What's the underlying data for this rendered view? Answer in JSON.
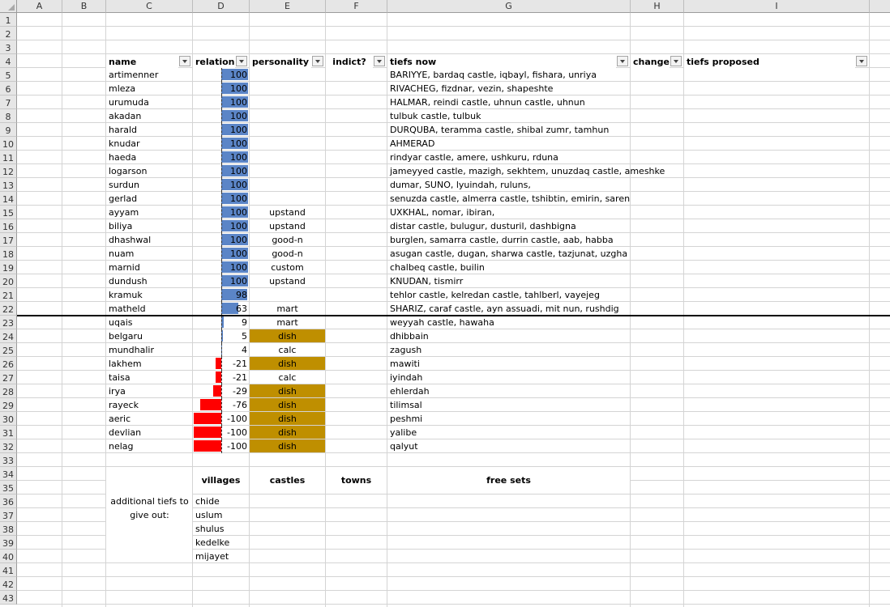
{
  "sheet": {
    "columns": [
      "A",
      "B",
      "C",
      "D",
      "E",
      "F",
      "G",
      "H",
      "I"
    ],
    "row_numbers": [
      1,
      2,
      3,
      4,
      5,
      6,
      7,
      8,
      9,
      10,
      11,
      12,
      13,
      14,
      15,
      16,
      17,
      18,
      19,
      20,
      21,
      22,
      23,
      24,
      25,
      26,
      27,
      28,
      29,
      30,
      31,
      32,
      33,
      34,
      35,
      36,
      37,
      38,
      39,
      40,
      41,
      42,
      43
    ]
  },
  "headers": {
    "name": "name",
    "relation": "relation",
    "personality": "personality",
    "indict": "indict?",
    "tiefs_now": "tiefs now",
    "changes": "changes?",
    "tiefs_proposed": "tiefs proposed"
  },
  "rows": [
    {
      "name": "artimenner",
      "relation": 100,
      "personality": "",
      "tiefs": "BARIYYE, bardaq castle, iqbayl, fishara, unriya"
    },
    {
      "name": "mleza",
      "relation": 100,
      "personality": "",
      "tiefs": "RIVACHEG, fizdnar, vezin, shapeshte"
    },
    {
      "name": "urumuda",
      "relation": 100,
      "personality": "",
      "tiefs": "HALMAR, reindi castle, uhnun castle, uhnun"
    },
    {
      "name": "akadan",
      "relation": 100,
      "personality": "",
      "tiefs": "tulbuk castle, tulbuk"
    },
    {
      "name": "harald",
      "relation": 100,
      "personality": "",
      "tiefs": "DURQUBA, teramma castle,  shibal zumr, tamhun"
    },
    {
      "name": "knudar",
      "relation": 100,
      "personality": "",
      "tiefs": "AHMERAD"
    },
    {
      "name": "haeda",
      "relation": 100,
      "personality": "",
      "tiefs": "rindyar castle, amere, ushkuru, rduna"
    },
    {
      "name": "logarson",
      "relation": 100,
      "personality": "",
      "tiefs": "jameyyed castle, mazigh, sekhtem, unuzdaq castle, ameshke"
    },
    {
      "name": "surdun",
      "relation": 100,
      "personality": "",
      "tiefs": "dumar, SUNO, lyuindah, ruluns,"
    },
    {
      "name": "gerlad",
      "relation": 100,
      "personality": "",
      "tiefs": "senuzda castle, almerra castle, tshibtin, emirin, saren"
    },
    {
      "name": "ayyam",
      "relation": 100,
      "personality": "upstand",
      "tiefs": "UXKHAL, nomar, ibiran,"
    },
    {
      "name": "biliya",
      "relation": 100,
      "personality": "upstand",
      "tiefs": "distar castle, bulugur, dusturil, dashbigna"
    },
    {
      "name": "dhashwal",
      "relation": 100,
      "personality": "good-n",
      "tiefs": "burglen, samarra castle, durrin castle, aab, habba"
    },
    {
      "name": "nuam",
      "relation": 100,
      "personality": "good-n",
      "tiefs": "asugan castle, dugan, sharwa castle, tazjunat, uzgha"
    },
    {
      "name": "marnid",
      "relation": 100,
      "personality": "custom",
      "tiefs": "chalbeq castle, builin"
    },
    {
      "name": "dundush",
      "relation": 100,
      "personality": "upstand",
      "tiefs": "KNUDAN, tismirr"
    },
    {
      "name": "kramuk",
      "relation": 98,
      "personality": "",
      "tiefs": "tehlor castle, kelredan castle, tahlberl, vayejeg"
    },
    {
      "name": "matheld",
      "relation": 63,
      "personality": "mart",
      "tiefs": "SHARIZ, caraf castle, ayn assuadi, mit nun, rushdig"
    },
    {
      "name": "uqais",
      "relation": 9,
      "personality": "mart",
      "tiefs": "weyyah castle, hawaha"
    },
    {
      "name": "belgaru",
      "relation": 5,
      "personality": "dish",
      "tiefs": "dhibbain"
    },
    {
      "name": "mundhalir",
      "relation": 4,
      "personality": "calc",
      "tiefs": "zagush"
    },
    {
      "name": "lakhem",
      "relation": -21,
      "personality": "dish",
      "tiefs": "mawiti"
    },
    {
      "name": "taisa",
      "relation": -21,
      "personality": "calc",
      "tiefs": "iyindah"
    },
    {
      "name": "irya",
      "relation": -29,
      "personality": "dish",
      "tiefs": "ehlerdah"
    },
    {
      "name": "rayeck",
      "relation": -76,
      "personality": "dish",
      "tiefs": "tilimsal"
    },
    {
      "name": "aeric",
      "relation": -100,
      "personality": "dish",
      "tiefs": "peshmi"
    },
    {
      "name": "devlian",
      "relation": -100,
      "personality": "dish",
      "tiefs": "yalibe"
    },
    {
      "name": "nelag",
      "relation": -100,
      "personality": "dish",
      "tiefs": "qalyut"
    }
  ],
  "extra": {
    "label_line1": "additional tiefs to",
    "label_line2": "give out:",
    "villages_header": "villages",
    "castles_header": "castles",
    "towns_header": "towns",
    "free_sets_header": "free sets",
    "villages": [
      "chide",
      "uslum",
      "shulus",
      "kedelke",
      "mijayet"
    ]
  },
  "colors": {
    "positive_bar": "#5b85c7",
    "negative_bar": "#ff0000",
    "dish_fill": "#bf8f00"
  }
}
